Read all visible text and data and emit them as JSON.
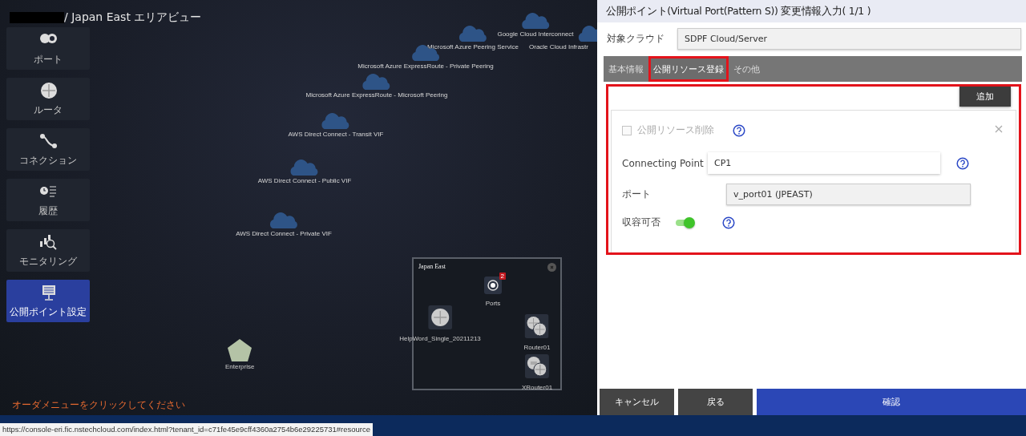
{
  "title": {
    "text": "/ Japan East エリアビュー"
  },
  "sidebar": {
    "items": [
      {
        "kind": "port",
        "label": "ポート",
        "selected": false
      },
      {
        "kind": "router",
        "label": "ルータ",
        "selected": false
      },
      {
        "kind": "connection",
        "label": "コネクション",
        "selected": false
      },
      {
        "kind": "history",
        "label": "履歴",
        "selected": false
      },
      {
        "kind": "monitoring",
        "label": "モニタリング",
        "selected": false
      },
      {
        "kind": "public-point",
        "label": "公開ポイント設定",
        "selected": true
      }
    ]
  },
  "canvas": {
    "clouds": [
      {
        "label": "Google Cloud Interconnect"
      },
      {
        "label": "Microsoft Azure Peering Service"
      },
      {
        "label": "Oracle Cloud Infrastr"
      },
      {
        "label": "Microsoft Azure ExpressRoute - Private Peering"
      },
      {
        "label": "Microsoft Azure ExpressRoute - Microsoft Peering"
      },
      {
        "label": "AWS Direct Connect - Transit VIF"
      },
      {
        "label": "AWS Direct Connect - Public VIF"
      },
      {
        "label": "AWS Direct Connect - Private VIF"
      }
    ],
    "enterprise": {
      "label": "Enterprise"
    },
    "hint": "オーダメニューをクリックしてください"
  },
  "minimap": {
    "title": "Japan East",
    "nodes": [
      {
        "kind": "port",
        "label": "Ports",
        "badge": "2"
      },
      {
        "kind": "router",
        "label": "HelpWord_Single_20211213"
      },
      {
        "kind": "router-pair",
        "label": "Router01"
      },
      {
        "kind": "xrouter-pair",
        "label": "XRouter01"
      }
    ]
  },
  "panel": {
    "title": "公開ポイント(Virtual Port(Pattern S)) 変更情報入力( 1/1 )",
    "cloud": {
      "label": "対象クラウド",
      "value": "SDPF Cloud/Server"
    },
    "tabs": [
      {
        "label": "基本情報",
        "selected": false,
        "annotated": false
      },
      {
        "label": "公開リソース登録",
        "selected": true,
        "annotated": true
      },
      {
        "label": "その他",
        "selected": false,
        "annotated": false
      }
    ],
    "resource": {
      "annotated": true,
      "add_button": "追加",
      "delete": {
        "label": "公開リソース削除",
        "checked": false,
        "disabled": true
      },
      "connecting_point": {
        "label": "Connecting Point",
        "value": "CP1"
      },
      "port": {
        "label": "ポート",
        "value": "v_port01 (JPEAST)"
      },
      "capacity": {
        "label": "収容可否",
        "on": true
      }
    },
    "buttons": [
      {
        "label": "キャンセル",
        "kind": "secondary"
      },
      {
        "label": "戻る",
        "kind": "secondary"
      },
      {
        "label": "確認",
        "kind": "primary"
      }
    ]
  },
  "status_bar": {
    "url": "https://console-eri.fic.nstechcloud.com/index.html?tenant_id=c71fe45e9cff4360a2754b6e29225731#resource"
  }
}
